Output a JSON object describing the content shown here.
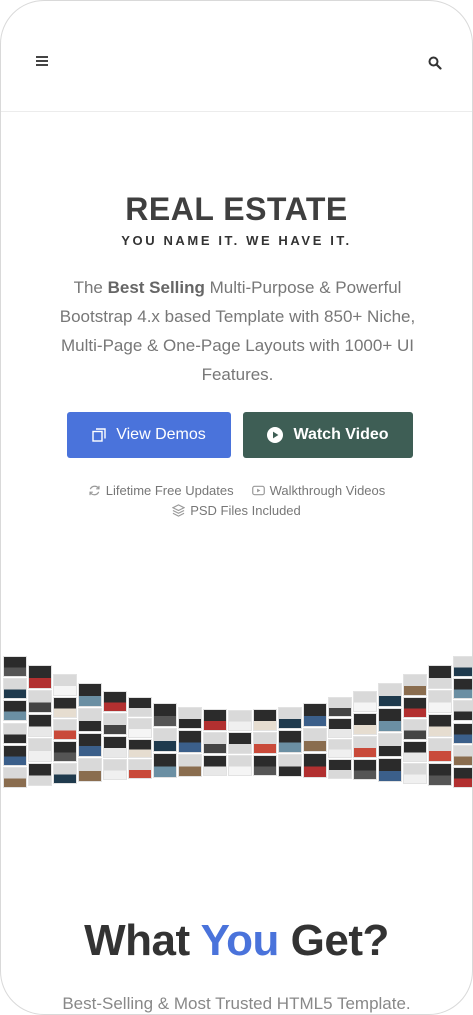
{
  "header": {
    "menu_icon": "hamburger-menu-icon",
    "search_icon": "search-icon"
  },
  "hero": {
    "title": "REAL ESTATE",
    "tagline": "YOU NAME IT. WE HAVE IT.",
    "desc_prefix": "The ",
    "desc_bold": "Best Selling",
    "desc_rest": " Multi-Purpose & Powerful Bootstrap 4.x based Template with 850+ Niche, Multi-Page & One-Page Layouts with 1000+ UI Features.",
    "view_demos_label": "View Demos",
    "watch_video_label": "Watch Video",
    "features": {
      "updates": "Lifetime Free Updates",
      "videos": "Walkthrough Videos",
      "psd": "PSD Files Included"
    }
  },
  "section": {
    "title_a": "What ",
    "title_accent": "You",
    "title_b": " Get?",
    "subtitle": "Best-Selling & Most Trusted HTML5 Template."
  },
  "colors": {
    "accent": "#4a73db",
    "video_button": "#3e5e55",
    "title": "#3f3f3f"
  }
}
